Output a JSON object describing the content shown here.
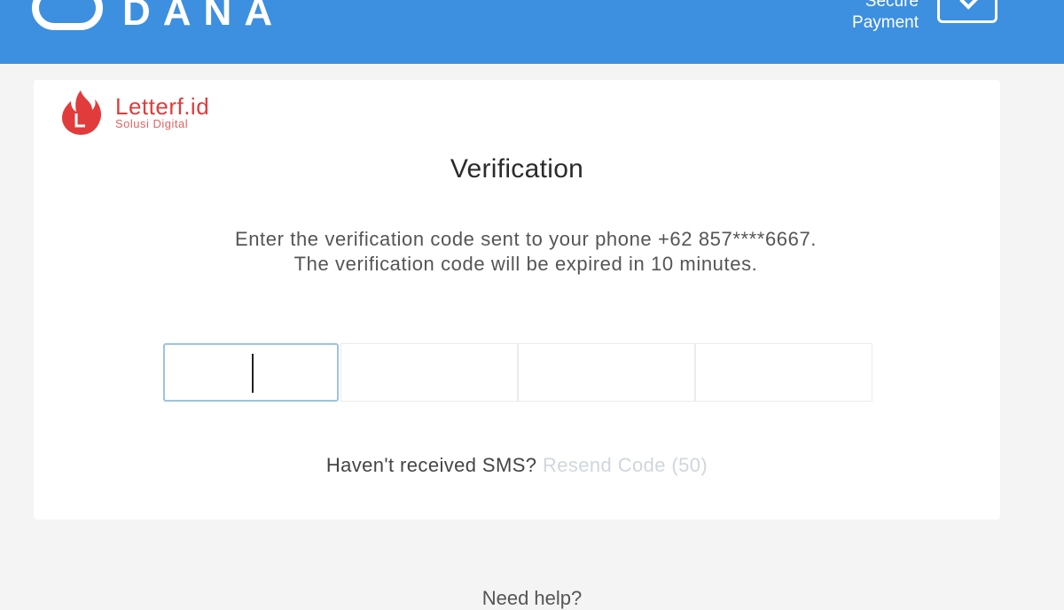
{
  "header": {
    "brand": "DANA",
    "secure_line1": "Secure",
    "secure_line2": "Payment",
    "bg_color": "#3d8fe0"
  },
  "logo": {
    "name": "Letterf.id",
    "tagline": "Solusi Digital",
    "color": "#e23b3b"
  },
  "verification": {
    "title": "Verification",
    "instructions": "Enter the verification code sent to your phone +62 857****6667. The verification code will be expired in 10 minutes.",
    "otp_values": [
      "",
      "",
      "",
      ""
    ]
  },
  "resend": {
    "question": "Haven't received SMS?",
    "link": "Resend Code (50)"
  },
  "footer": {
    "partial_text": "Need help?"
  }
}
